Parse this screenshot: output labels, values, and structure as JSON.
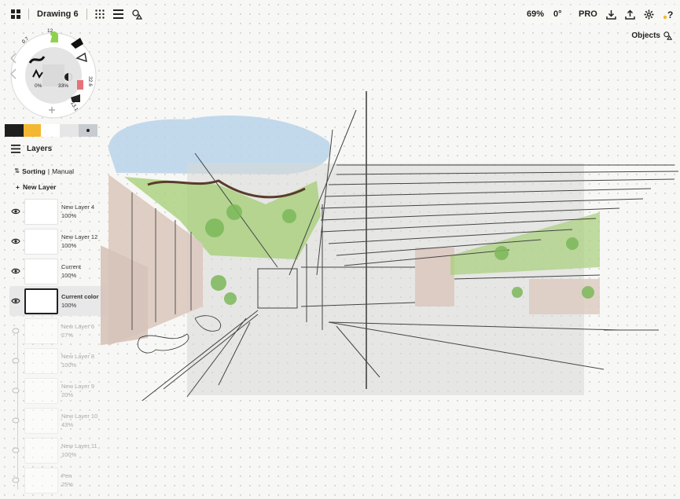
{
  "app": {
    "title": "Drawing 6",
    "zoom": "69%",
    "rotation": "0°",
    "pro_label": "PRO",
    "objects_label": "Objects"
  },
  "brush": {
    "size": "12",
    "opacity_value": "0%",
    "smoothing_value": "33%",
    "left_value": "0.7",
    "right_value": "32.6",
    "bottom_value": "13.1"
  },
  "colors": [
    "#1e1e1e",
    "#f4b731",
    "#ffffff",
    "#e6e6e6",
    "#c8ccd0"
  ],
  "layers_panel": {
    "title": "Layers",
    "sorting_label": "Sorting",
    "sorting_value": "Manual",
    "new_layer_label": "New Layer",
    "items": [
      {
        "name": "New Layer 4",
        "opacity": "100%",
        "visible": true,
        "selected": false
      },
      {
        "name": "New Layer 12",
        "opacity": "100%",
        "visible": true,
        "selected": false
      },
      {
        "name": "Current",
        "opacity": "100%",
        "visible": true,
        "selected": false
      },
      {
        "name": "Current color",
        "opacity": "100%",
        "visible": true,
        "selected": true
      },
      {
        "name": "New Layer 6",
        "opacity": "27%",
        "visible": false,
        "selected": false
      },
      {
        "name": "New Layer 8",
        "opacity": "100%",
        "visible": false,
        "selected": false
      },
      {
        "name": "New Layer 9",
        "opacity": "20%",
        "visible": false,
        "selected": false
      },
      {
        "name": "New Layer 10",
        "opacity": "43%",
        "visible": false,
        "selected": false
      },
      {
        "name": "New Layer 11",
        "opacity": "100%",
        "visible": false,
        "selected": false
      },
      {
        "name": "Pen",
        "opacity": "25%",
        "visible": false,
        "selected": false
      }
    ]
  },
  "icons": {
    "app_menu": "grid-four-icon",
    "gallery": "dots-grid-icon",
    "layers": "stack-lines-icon",
    "shapes": "shapes-icon",
    "export": "download-icon",
    "share": "upload-icon",
    "settings": "gear-icon",
    "help": "question-icon"
  }
}
